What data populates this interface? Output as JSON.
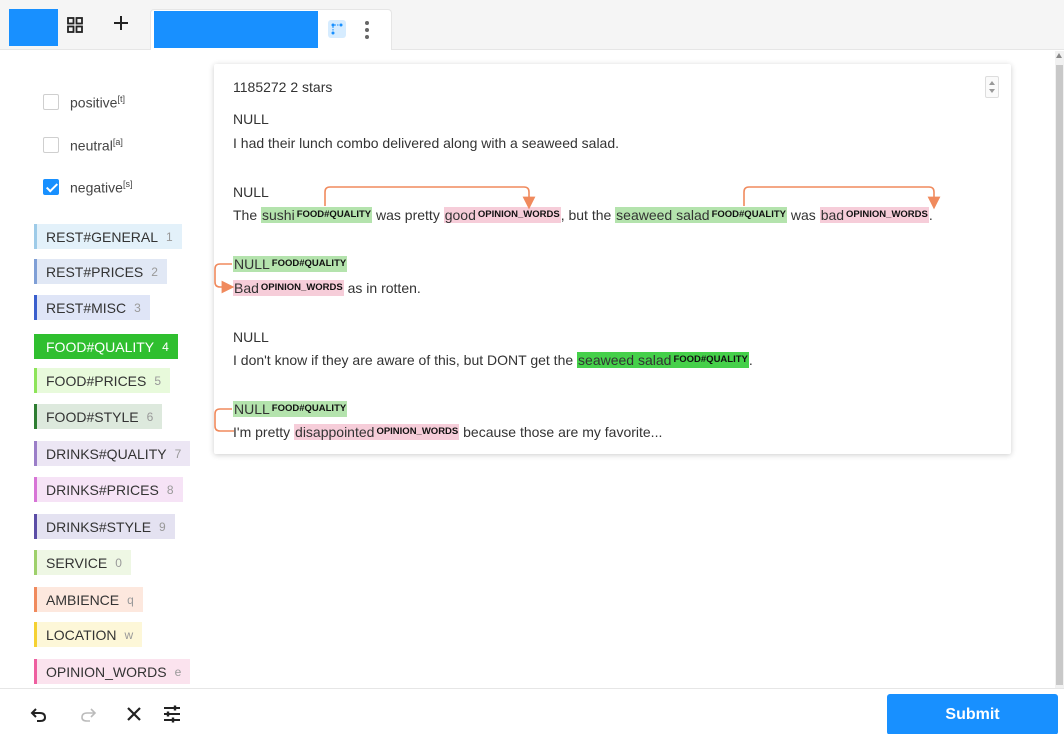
{
  "choices": [
    {
      "label": "positive",
      "hotkey": "[t]",
      "checked": false
    },
    {
      "label": "neutral",
      "hotkey": "[a]",
      "checked": false
    },
    {
      "label": "negative",
      "hotkey": "[s]",
      "checked": true
    }
  ],
  "labels": [
    {
      "name": "REST#GENERAL",
      "hotkey": "1",
      "color": "#9ecbe8",
      "bg": "#e3f1fa"
    },
    {
      "name": "REST#PRICES",
      "hotkey": "2",
      "color": "#7f9fd6",
      "bg": "#e1e8f5"
    },
    {
      "name": "REST#MISC",
      "hotkey": "3",
      "color": "#3a5fcd",
      "bg": "#dfe5f7"
    },
    {
      "name": "FOOD#QUALITY",
      "hotkey": "4",
      "color": "#2fbf2f",
      "bg": "#2fbf2f",
      "selected": true
    },
    {
      "name": "FOOD#PRICES",
      "hotkey": "5",
      "color": "#8ee45a",
      "bg": "#e8fadb"
    },
    {
      "name": "FOOD#STYLE",
      "hotkey": "6",
      "color": "#2e7d32",
      "bg": "#dde9dd"
    },
    {
      "name": "DRINKS#QUALITY",
      "hotkey": "7",
      "color": "#9b7ec8",
      "bg": "#ece6f4"
    },
    {
      "name": "DRINKS#PRICES",
      "hotkey": "8",
      "color": "#d774d6",
      "bg": "#f6e3f6"
    },
    {
      "name": "DRINKS#STYLE",
      "hotkey": "9",
      "color": "#5b4da6",
      "bg": "#e4e2f1"
    },
    {
      "name": "SERVICE",
      "hotkey": "0",
      "color": "#9ed06b",
      "bg": "#eef7e4"
    },
    {
      "name": "AMBIENCE",
      "hotkey": "q",
      "color": "#f08a5d",
      "bg": "#fde8de"
    },
    {
      "name": "LOCATION",
      "hotkey": "w",
      "color": "#f5d132",
      "bg": "#fdf7d8"
    },
    {
      "name": "OPINION_WORDS",
      "hotkey": "e",
      "color": "#ee5fa0",
      "bg": "#fbe3ee"
    }
  ],
  "document": {
    "header": "1185272 2 stars",
    "null_label": "NULL",
    "s1": "I had their lunch combo delivered along with a seaweed salad.",
    "s2": {
      "w1": "The ",
      "sushi": "sushi",
      "tag_food": "FOOD#QUALITY",
      "w2": " was pretty ",
      "good": "good",
      "tag_op": "OPINION_WORDS",
      "w3": ", but the ",
      "seaweed": "seaweed salad",
      "w4": " was ",
      "bad": "bad",
      "w5": "."
    },
    "s3": {
      "Bad": "Bad",
      "rest": " as in rotten."
    },
    "s4": {
      "pre": "I don't know if they are aware of this, but DONT get the ",
      "seaweed": "seaweed salad",
      "post": "."
    },
    "s5": {
      "pre": "I'm pretty ",
      "disappointed": "disappointed",
      "post": " because those are my favorite..."
    }
  },
  "toolbar": {
    "submit_label": "Submit",
    "icons": [
      "undo-icon",
      "redo-icon",
      "close-icon",
      "settings-sliders-icon"
    ]
  },
  "colors": {
    "accent": "#1890ff",
    "arrow": "#f08a5d"
  }
}
